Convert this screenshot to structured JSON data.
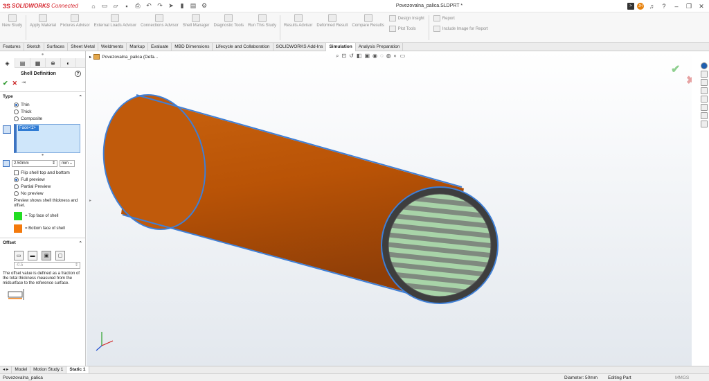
{
  "app": {
    "brand_ds": "3S",
    "brand_name": "SOLIDWORKS",
    "brand_suffix": "Connected",
    "doc_title": "Povezovalna_palica.SLDPRT *",
    "user_initials": "JH"
  },
  "ribbon": {
    "buttons": [
      "New Study",
      "Apply Material",
      "Fixtures Advisor",
      "External Loads Advisor",
      "Connections Advisor",
      "Shell Manager",
      "Diagnostic Tools",
      "Run This Study",
      "Results Advisor",
      "Deformed Result",
      "Compare Results"
    ],
    "small": [
      "Design Insight",
      "Plot Tools",
      "Report",
      "Include Image for Report"
    ]
  },
  "tabs": [
    "Features",
    "Sketch",
    "Surfaces",
    "Sheet Metal",
    "Weldments",
    "Markup",
    "Evaluate",
    "MBD Dimensions",
    "Lifecycle and Collaboration",
    "SOLIDWORKS Add-Ins",
    "Simulation",
    "Analysis Preparation"
  ],
  "active_tab": "Simulation",
  "pm": {
    "title": "Shell Definition",
    "type_label": "Type",
    "type_options": [
      "Thin",
      "Thick",
      "Composite"
    ],
    "face_item": "Face<1>",
    "thickness_value": "2.50mm",
    "unit_value": "mm",
    "flip_label": "Flip shell top and bottom",
    "preview_options": [
      "Full preview",
      "Partial Preview",
      "No preview"
    ],
    "preview_note": "Preview shows shell thickness and offset.",
    "top_face_label": "= Top face of shell",
    "bottom_face_label": "= Bottom face of shell",
    "top_color": "#22dd22",
    "bottom_color": "#f47a0c",
    "offset_label": "Offset",
    "offset_value": "-0.5",
    "offset_note": "The offset value is defined as a fraction of the total thickness measured from the midsurface to the reference surface."
  },
  "viewport": {
    "tree_label": "Povezovalna_palica (Defa...",
    "tube_color": "#c0580b",
    "edge_color": "#3f7fd6"
  },
  "bottom_tabs": [
    "Model",
    "Motion Study 1",
    "Static 1"
  ],
  "active_bottom_tab": "Static 1",
  "status": {
    "left": "Povezovalna_palica",
    "diameter": "Diameter: 50mm",
    "mode": "Editing Part",
    "units": "MMGS"
  }
}
